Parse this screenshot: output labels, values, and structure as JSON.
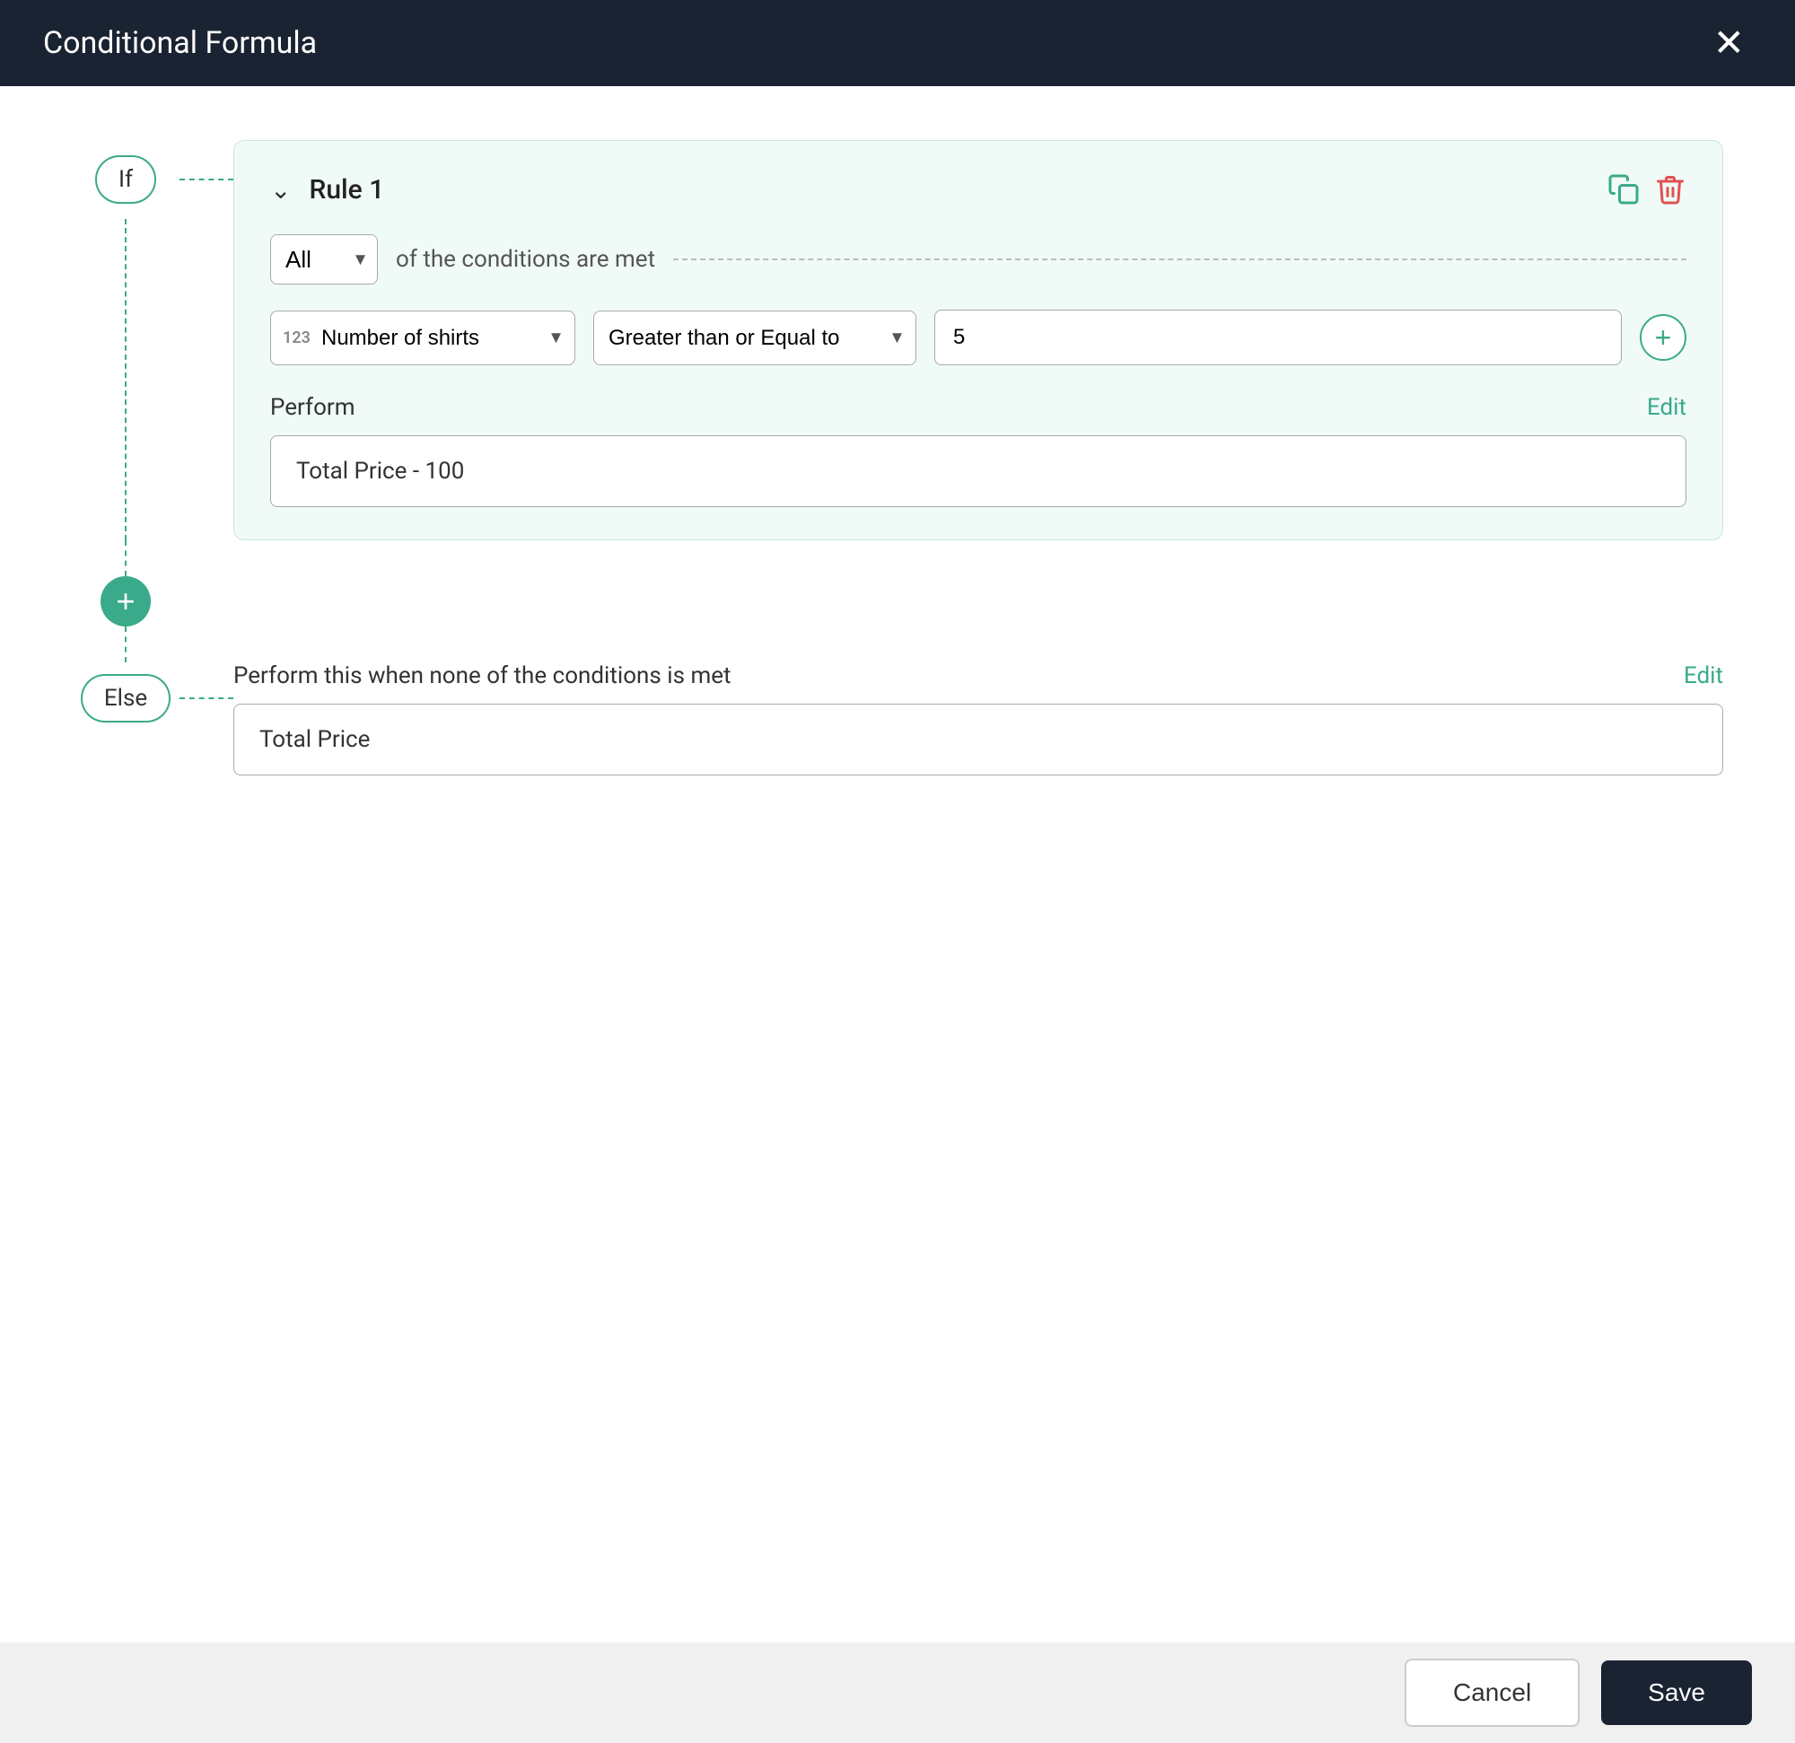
{
  "header": {
    "title": "Conditional Formula",
    "close_label": "×"
  },
  "footer": {
    "cancel_label": "Cancel",
    "save_label": "Save"
  },
  "flow": {
    "if_label": "If",
    "else_label": "Else",
    "add_rule_icon": "+",
    "rule": {
      "title": "Rule 1",
      "copy_icon": "⧉",
      "delete_icon": "🗑",
      "conditions_all_label": "All",
      "conditions_text": "of the conditions are met",
      "condition": {
        "field_icon": "123",
        "field_value": "Number of shirts",
        "operator_value": "Greater than or Equal to",
        "value": "5",
        "add_icon": "+"
      },
      "perform_label": "Perform",
      "perform_edit_label": "Edit",
      "perform_value": "Total Price - 100"
    },
    "else_section": {
      "perform_when_text": "Perform this when none of the conditions is met",
      "edit_label": "Edit",
      "else_value": "Total Price"
    }
  },
  "icons": {
    "close": "✕",
    "chevron_down": "›",
    "copy": "⧉",
    "delete": "🗑",
    "add": "+"
  }
}
